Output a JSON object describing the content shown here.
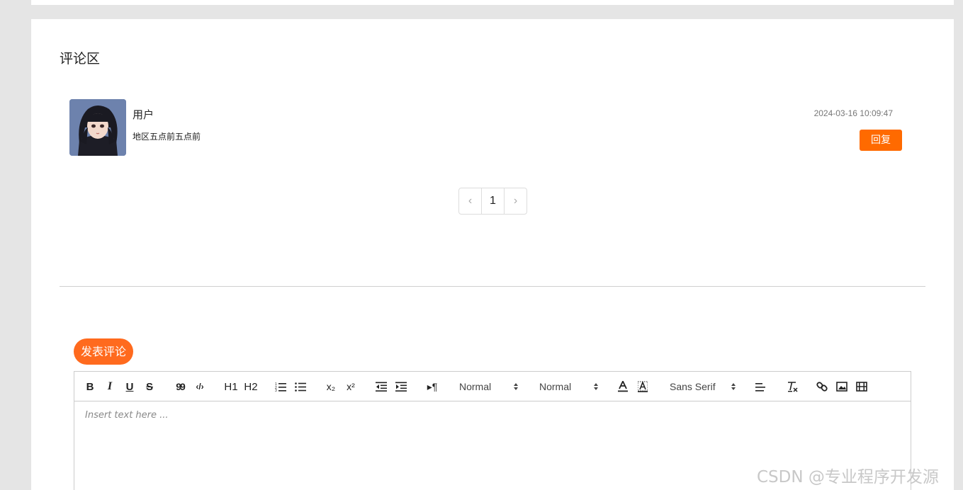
{
  "section": {
    "title": "评论区"
  },
  "comment": {
    "username": "用户",
    "text": "地区五点前五点前",
    "timestamp": "2024-03-16 10:09:47",
    "reply_label": "回复"
  },
  "pagination": {
    "prev": "‹",
    "current": "1",
    "next": "›"
  },
  "post": {
    "button_label": "发表评论"
  },
  "editor": {
    "placeholder": "Insert text here ...",
    "header_picker": "Normal",
    "size_picker": "Normal",
    "font_picker": "Sans Serif",
    "buttons": {
      "bold": "B",
      "italic": "I",
      "underline": "U",
      "strike": "S",
      "quote": "99",
      "code": "‹/›",
      "h1": "H1",
      "h2": "H2",
      "subscript": "x₂",
      "superscript": "x²",
      "direction": "▸¶"
    }
  },
  "watermark": "CSDN @专业程序开发源"
}
